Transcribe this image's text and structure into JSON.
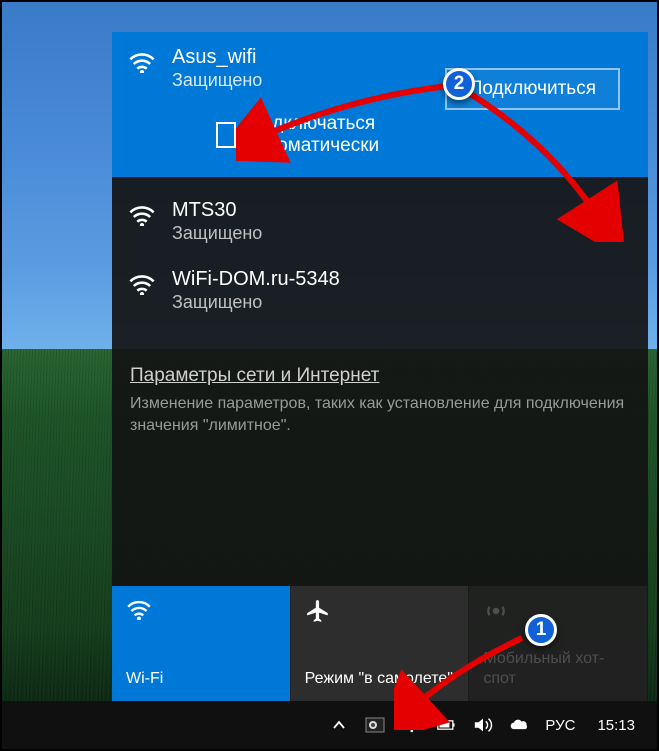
{
  "networks": [
    {
      "name": "Asus_wifi",
      "status": "Защищено",
      "selected": true
    },
    {
      "name": "MTS30",
      "status": "Защищено",
      "selected": false
    },
    {
      "name": "WiFi-DOM.ru-5348",
      "status": "Защищено",
      "selected": false
    }
  ],
  "auto_connect_label": "Подключаться автоматически",
  "connect_button": "Подключиться",
  "settings": {
    "link": "Параметры сети и Интернет",
    "description": "Изменение параметров, таких как установление для подключения значения \"лимитное\"."
  },
  "tiles": [
    {
      "label": "Wi-Fi",
      "icon": "wifi",
      "state": "active"
    },
    {
      "label": "Режим \"в самолете\"",
      "icon": "airplane",
      "state": "inactive"
    },
    {
      "label": "Мобильный хот-спот",
      "icon": "hotspot",
      "state": "disabled"
    }
  ],
  "tray": {
    "lang": "РУС",
    "time": "15:13"
  },
  "badges": {
    "b1": "1",
    "b2": "2"
  }
}
